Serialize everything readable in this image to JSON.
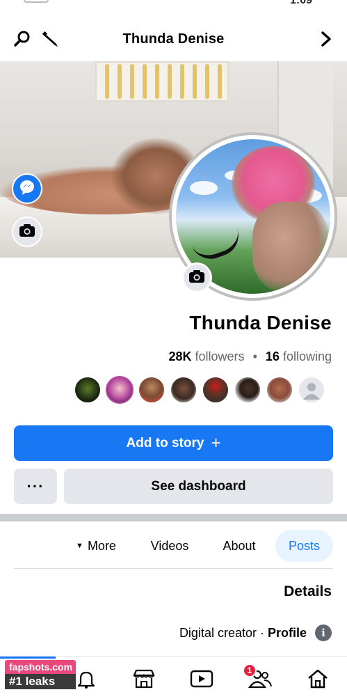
{
  "header": {
    "title": "Thunda Denise"
  },
  "status_bar": {
    "time_fragment": "1:09"
  },
  "profile": {
    "name": "Thunda Denise",
    "followers_count": "28K",
    "followers_label": "followers",
    "following_count": "16",
    "following_label": "following",
    "separator": "•"
  },
  "actions": {
    "add_story_label": "Add to story",
    "add_story_icon": "+",
    "dashboard_label": "See dashboard",
    "more_label": "···"
  },
  "tabs": [
    {
      "label": "Posts",
      "active": true
    },
    {
      "label": "About",
      "active": false
    },
    {
      "label": "Videos",
      "active": false
    },
    {
      "label": "More",
      "active": false
    }
  ],
  "details": {
    "heading": "Details",
    "profile_type_label": "Profile",
    "profile_type_separator": " · ",
    "profile_type_value": "Digital creator"
  },
  "bottom_nav": {
    "friends_badge": "1",
    "notifications_badge": ""
  },
  "watermark": {
    "site": "fapshots.com",
    "tagline": "#1 leaks"
  },
  "colors": {
    "accent": "#1877f2",
    "button_gray": "#e4e6eb",
    "tab_active_bg": "#e7f3ff",
    "badge_red": "#e41e3f"
  },
  "icons": {
    "header": [
      "search-icon",
      "edit-pencil-icon",
      "chevron-right-icon"
    ],
    "cover": [
      "messenger-icon",
      "camera-icon"
    ],
    "avatar": [
      "camera-icon"
    ],
    "bottom_nav": [
      "home-icon",
      "friends-icon",
      "video-icon",
      "marketplace-icon",
      "bell-icon",
      "menu-icon"
    ]
  }
}
